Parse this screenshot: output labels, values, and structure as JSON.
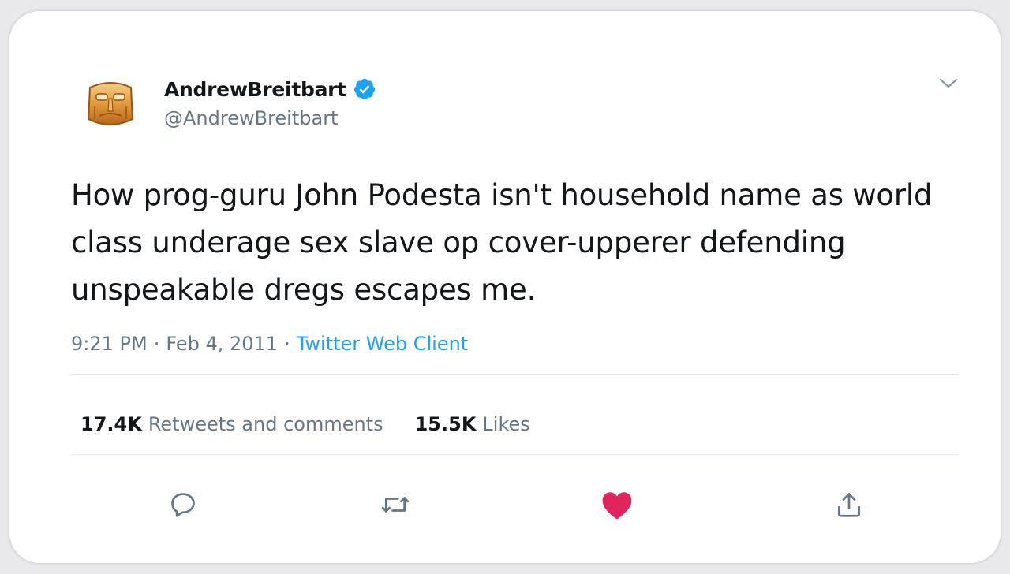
{
  "author": {
    "display_name": "AndrewBreitbart",
    "handle": "@AndrewBreitbart",
    "verified": true,
    "avatar_icon": "golden-face-mask-avatar"
  },
  "tweet": {
    "text": "How prog-guru John Podesta isn't household name as world class underage sex slave op cover-upperer defending unspeakable dregs escapes me.",
    "time": "9:21 PM",
    "date": "Feb 4, 2011",
    "separator": "·",
    "source": "Twitter Web Client"
  },
  "stats": {
    "retweets_count": "17.4K",
    "retweets_label": "Retweets and comments",
    "likes_count": "15.5K",
    "likes_label": "Likes"
  },
  "actions": {
    "reply_icon": "reply-icon",
    "retweet_icon": "retweet-icon",
    "like_icon": "heart-icon",
    "share_icon": "share-icon",
    "liked": true
  },
  "colors": {
    "accent": "#1da1f2",
    "like_red": "#e0245e",
    "text_primary": "#14171a",
    "text_secondary": "#657786"
  }
}
